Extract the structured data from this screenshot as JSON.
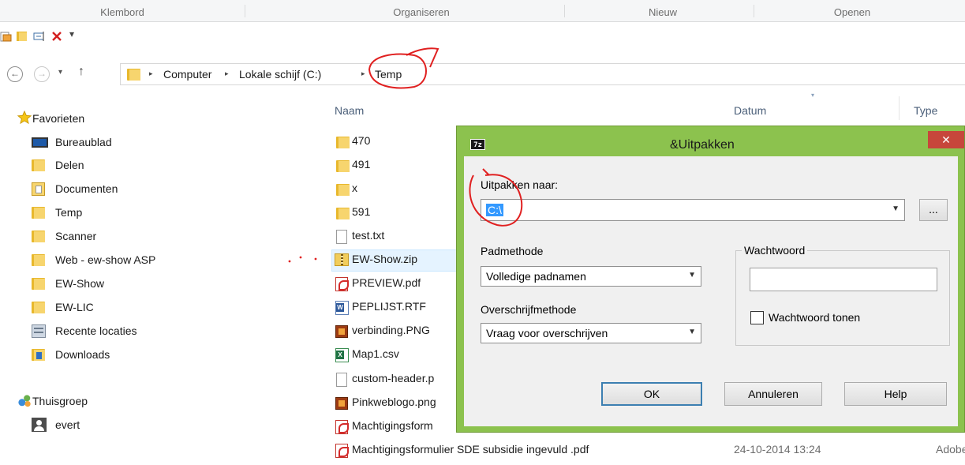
{
  "ribbon": {
    "groups": [
      "Klembord",
      "Organiseren",
      "Nieuw",
      "Openen"
    ]
  },
  "quick_access": {
    "icons": [
      "properties-icon",
      "new-folder-icon",
      "rename-icon",
      "delete-icon",
      "customize-chevron-icon"
    ],
    "customize_glyph": "▾"
  },
  "address": {
    "back_glyph": "←",
    "forward_glyph": "→",
    "recent_glyph": "▾",
    "up_glyph": "↑",
    "crumbs": [
      "Computer",
      "Lokale schijf (C:)",
      "Temp"
    ],
    "separator": "▸"
  },
  "nav_pane": {
    "favorites_header": "Favorieten",
    "favorites": [
      "Bureaublad",
      "Delen",
      "Documenten",
      "Temp",
      "Scanner",
      "Web - ew-show ASP",
      "EW-Show",
      "EW-LIC",
      "Recente locaties",
      "Downloads"
    ],
    "homegroup_header": "Thuisgroep",
    "homegroup_items": [
      "evert"
    ]
  },
  "file_list": {
    "columns": {
      "name": "Naam",
      "date": "Datum",
      "type": "Type"
    },
    "files": [
      {
        "name": "470",
        "icon": "folder-icon"
      },
      {
        "name": "491",
        "icon": "folder-icon"
      },
      {
        "name": "x",
        "icon": "folder-icon"
      },
      {
        "name": "591",
        "icon": "folder-icon"
      },
      {
        "name": "test.txt",
        "icon": "text-file-icon"
      },
      {
        "name": "EW-Show.zip",
        "icon": "zip-file-icon",
        "selected": true
      },
      {
        "name": "PREVIEW.pdf",
        "icon": "pdf-file-icon"
      },
      {
        "name": "PEPLIJST.RTF",
        "icon": "word-file-icon"
      },
      {
        "name": "verbinding.PNG",
        "icon": "image-file-icon"
      },
      {
        "name": "Map1.csv",
        "icon": "excel-file-icon"
      },
      {
        "name": "custom-header.p",
        "icon": "text-file-icon"
      },
      {
        "name": "Pinkweblogo.png",
        "icon": "image-file-icon"
      },
      {
        "name": "Machtigingsform",
        "icon": "pdf-file-icon"
      },
      {
        "name": "Machtigingsformulier SDE subsidie ingevuld .pdf",
        "icon": "pdf-file-icon",
        "date": "24-10-2014 13:24",
        "type": "Adobe A"
      }
    ]
  },
  "dialog": {
    "app_icon_text": "7z",
    "title": "&Uitpakken",
    "close_glyph": "✕",
    "extract_to_label": "Uitpakken naar:",
    "extract_to_value": "C:\\",
    "browse_label": "...",
    "path_mode_label": "Padmethode",
    "path_mode_value": "Volledige padnamen",
    "overwrite_mode_label": "Overschrijfmethode",
    "overwrite_mode_value": "Vraag voor overschrijven",
    "password_group_label": "Wachtwoord",
    "password_value": "",
    "show_password_label": "Wachtwoord tonen",
    "show_password_checked": false,
    "ok_label": "OK",
    "cancel_label": "Annuleren",
    "help_label": "Help"
  },
  "colors": {
    "dialog_frame": "#8cc24e",
    "close_button": "#c7463b",
    "annotation": "#e02020",
    "selection": "#3399ff"
  }
}
